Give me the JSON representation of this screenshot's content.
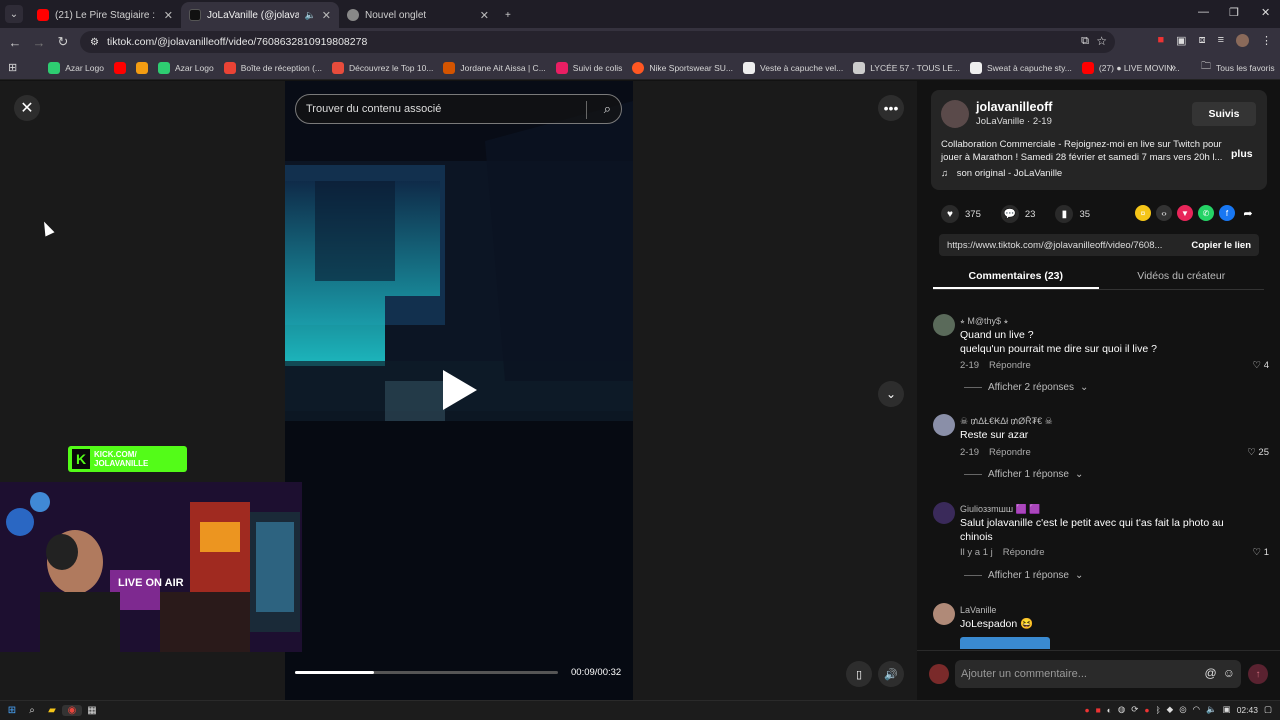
{
  "browser": {
    "tabs": [
      {
        "title": "(21) Le Pire Stagiaire : le gérant",
        "favicon_color": "#ff0000",
        "active": false
      },
      {
        "title": "JoLaVanille (@jolavanilleoff)",
        "favicon_color": "#111111",
        "active": true
      },
      {
        "title": "Nouvel onglet",
        "favicon_color": "#888888",
        "active": false
      }
    ],
    "new_tab": "+",
    "url": "tiktok.com/@jolavanilleoff/video/7608632810919808278",
    "bookmarks": [
      {
        "label": "Azar Logo",
        "color": "#2ecc71"
      },
      {
        "label": "",
        "color": "#ff0000"
      },
      {
        "label": "",
        "color": "#f39c12"
      },
      {
        "label": "Azar Logo",
        "color": "#2ecc71"
      },
      {
        "label": "Boîte de réception (...",
        "color": "#ea4335"
      },
      {
        "label": "Découvrez le Top 10...",
        "color": "#e74c3c"
      },
      {
        "label": "Jordane Ait Aissa | C...",
        "color": "#d35400"
      },
      {
        "label": "Suivi de colis",
        "color": "#e91e63"
      },
      {
        "label": "Nike Sportswear SU...",
        "color": "#ff5722"
      },
      {
        "label": "Veste à capuche vel...",
        "color": "#eeeeee"
      },
      {
        "label": "LYCÉE 57 - TOUS LE...",
        "color": "#cccccc"
      },
      {
        "label": "Sweat à capuche sty...",
        "color": "#eeeeee"
      },
      {
        "label": "(27) ● LIVE MOVIN...",
        "color": "#ff0000"
      }
    ],
    "all_bookmarks": "Tous les favoris",
    "overflow": "»"
  },
  "video": {
    "search_placeholder": "Trouver du contenu associé",
    "time": "00:09/00:32",
    "progress": 0.3
  },
  "overlay": {
    "kick_line1": "KICK.COM/",
    "kick_line2": "JOLAVANILLE",
    "webcam_sign": "LIVE ON AIR"
  },
  "post": {
    "username": "jolavanilleoff",
    "subname": "JoLaVanille · 2-19",
    "follow": "Suivis",
    "description": "Collaboration Commerciale - Rejoignez-moi en live sur Twitch pour jouer à Marathon ! Samedi 28 février et samedi 7 mars vers 20h l...",
    "more": "plus",
    "sound": "son original - JoLaVanille",
    "likes": "375",
    "comments": "23",
    "saves": "35",
    "link": "https://www.tiktok.com/@jolavanilleoff/video/7608...",
    "copy_link": "Copier le lien",
    "tab_comments": "Commentaires (23)",
    "tab_creator": "Vidéos du créateur"
  },
  "comments": [
    {
      "name": "⭒ M@thy$ ⭒",
      "text": "Quand un live ?\nquelqu'un pourrait me dire sur quoi il live ?",
      "date": "2-19",
      "reply": "Répondre",
      "likes": "4",
      "replies": "Afficher 2 réponses",
      "avatar_color": "#5a6a5a"
    },
    {
      "name": "☠ ₥ΔŁ€₭Δł ₥ØŘ₮€ ☠",
      "text": "Reste sur azar",
      "date": "2-19",
      "reply": "Répondre",
      "likes": "25",
      "replies": "Afficher 1 réponse",
      "avatar_color": "#8a8fa8"
    },
    {
      "name": "Giulioззmшш 🟪 🟪",
      "text": "Salut jolavanille c'est le petit avec qui t'as fait la photo au chinois",
      "date": "Il y a 1 j",
      "reply": "Répondre",
      "likes": "1",
      "replies": "Afficher 1 réponse",
      "avatar_color": "#3a2a5a"
    },
    {
      "name": "LaVanille",
      "text": "JoLespadon 😆",
      "date": "",
      "reply": "",
      "likes": "",
      "replies": "",
      "avatar_color": "#b08a78"
    }
  ],
  "comment_input": "Ajouter un commentaire...",
  "taskbar": {
    "time": "02:43"
  }
}
